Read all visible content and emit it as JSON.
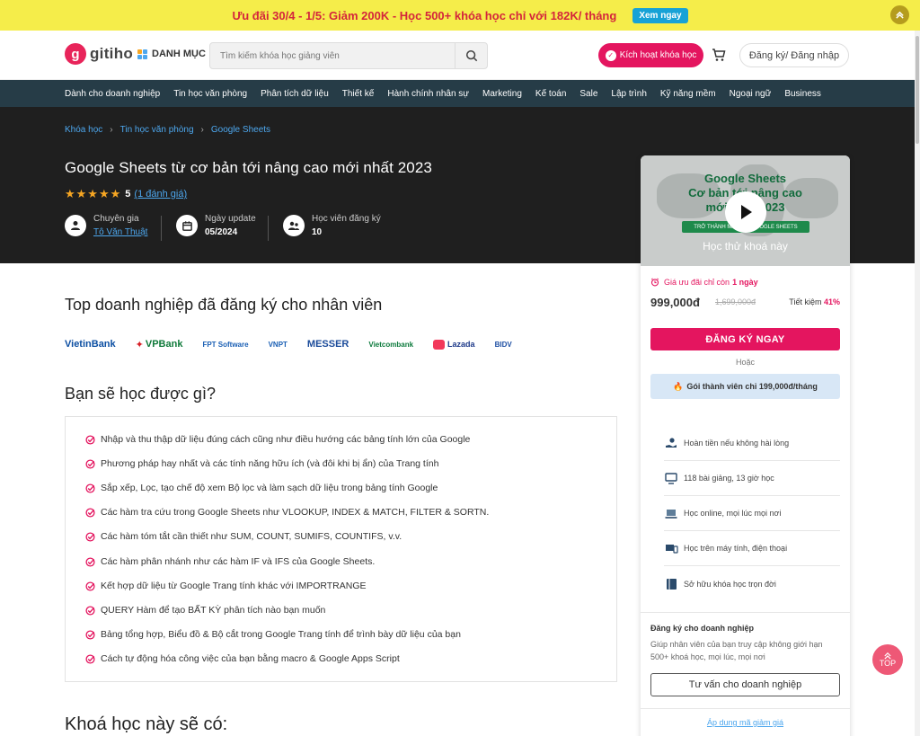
{
  "promo": {
    "text": "Ưu đãi 30/4 - 1/5: Giảm 200K - Học 500+ khóa học chỉ với 182K/ tháng",
    "button": "Xem ngay"
  },
  "header": {
    "logo_text": "gitiho",
    "logo_mark": "g",
    "category": "DANH MỤC",
    "search_placeholder": "Tìm kiếm khóa học giảng viên",
    "activate": "Kích hoạt khóa học",
    "login": "Đăng ký/ Đăng nhập"
  },
  "nav": [
    "Dành cho doanh nghiệp",
    "Tin học văn phòng",
    "Phân tích dữ liệu",
    "Thiết kế",
    "Hành chính nhân sự",
    "Marketing",
    "Kế toán",
    "Sale",
    "Lập trình",
    "Kỹ năng mềm",
    "Ngoại ngữ",
    "Business"
  ],
  "breadcrumb": [
    "Khóa học",
    "Tin học văn phòng",
    "Google Sheets"
  ],
  "course": {
    "title": "Google Sheets từ cơ bản tới nâng cao mới nhất 2023",
    "stars": "★★★★★",
    "rating": "5",
    "rating_count": "(1 đánh giá)",
    "expert_label": "Chuyên gia",
    "expert_name": "Tô Văn Thuật",
    "update_label": "Ngày update",
    "update_value": "05/2024",
    "students_label": "Học viên đăng ký",
    "students_value": "10"
  },
  "card": {
    "preview_line1": "Google Sheets",
    "preview_line2": "Cơ bản tới nâng cao",
    "preview_line3": "mới nhất 2023",
    "preview_badge": "TRỞ THÀNH MASTER GOOGLE SHEETS",
    "preview_try": "Học thử khoá này",
    "deal_text": "Giá ưu đãi chỉ còn",
    "deal_days": "1 ngày",
    "price": "999,000đ",
    "old_price": "1,699,000đ",
    "save_label": "Tiết kiệm",
    "save_pct": "41%",
    "buy": "ĐĂNG KÝ NGAY",
    "or": "Hoặc",
    "member": "Gói thành viên chỉ 199,000đ/tháng",
    "benefits": [
      "Hoàn tiền nếu không hài lòng",
      "118 bài giảng, 13 giờ học",
      "Học online, mọi lúc mọi nơi",
      "Học trên máy tính, điện thoại",
      "Sở hữu khóa học trọn đời"
    ],
    "biz_title": "Đăng ký cho doanh nghiệp",
    "biz_desc": "Giúp nhân viên của bạn truy cập không giới hạn 500+ khoá học, mọi lúc, mọi nơi",
    "biz_button": "Tư vấn cho doanh nghiệp",
    "coupon": "Áp dụng mã giảm giá"
  },
  "enterprise": {
    "heading": "Top doanh nghiệp đã đăng ký cho nhân viên",
    "logos": [
      "VietinBank",
      "VPBank",
      "FPT Software",
      "VNPT",
      "MESSER",
      "Vietcombank",
      "Lazada",
      "BIDV"
    ]
  },
  "learn": {
    "heading": "Bạn sẽ học được gì?",
    "items": [
      "Nhập và thu thập dữ liệu đúng cách cũng như điều hướng các bảng tính lớn của Google",
      "Phương pháp hay nhất và các tính năng hữu ích (và đôi khi bị ẩn) của Trang tính",
      "Sắp xếp, Lọc, tạo chế độ xem Bộ lọc và làm sạch dữ liệu trong bảng tính Google",
      "Các hàm tra cứu trong Google Sheets như VLOOKUP, INDEX & MATCH, FILTER & SORTN.",
      "Các hàm tóm tắt cần thiết như SUM, COUNT, SUMIFS, COUNTIFS, v.v.",
      "Các hàm phân nhánh như các hàm IF và IFS của Google Sheets.",
      "Kết hợp dữ liệu từ Google Trang tính khác với IMPORTRANGE",
      "QUERY Hàm để tạo BẤT KỲ phân tích nào bạn muốn",
      "Bảng tổng hợp, Biểu đồ & Bộ cắt trong Google Trang tính để trình bày dữ liệu của bạn",
      "Cách tự động hóa công việc của bạn bằng macro & Google Apps Script"
    ]
  },
  "includes_heading": "Khoá học này sẽ có:",
  "scroll_top": "TOP",
  "colors": {
    "brand": "#e4155f",
    "nav": "#263c47",
    "hero": "#1f1f1f",
    "link": "#4da7ee",
    "promo": "#f5ed4a"
  }
}
